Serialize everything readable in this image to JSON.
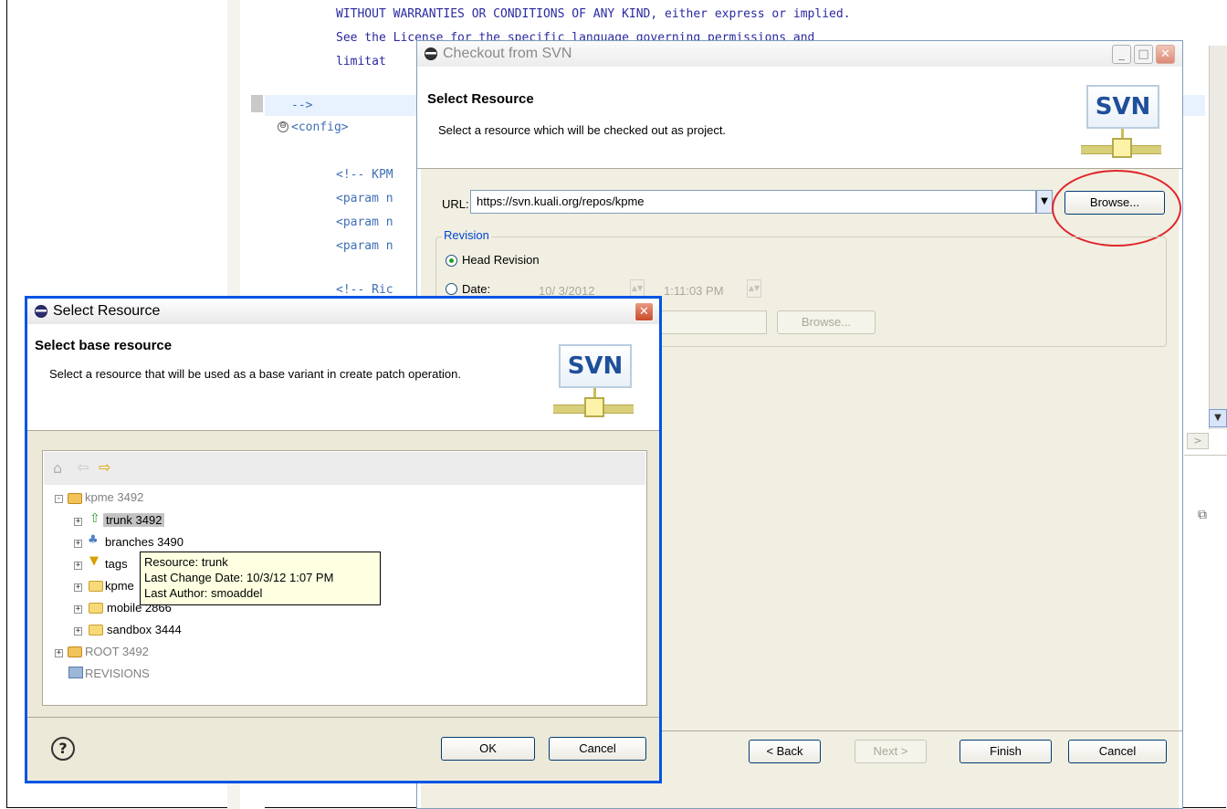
{
  "editor": {
    "lines": [
      "WITHOUT WARRANTIES OR CONDITIONS OF ANY KIND, either express or implied.",
      "See the License for the specific language governing permissions and",
      "limitat",
      "-->",
      "<config>",
      "<!-- KPM",
      "<param n",
      "<param n",
      "<param n",
      "<!-- Ric"
    ],
    "fold_symbol": "⊖"
  },
  "checkout": {
    "title": "Checkout from SVN",
    "header_title": "Select Resource",
    "header_desc": "Select a resource which will be checked out as project.",
    "logo_text": "SVN",
    "url_label": "URL:",
    "url_value": "https://svn.kuali.org/repos/kpme",
    "browse_label": "Browse...",
    "revision_legend": "Revision",
    "head_revision": "Head Revision",
    "date_label": "Date:",
    "date_value": "10/ 3/2012",
    "time_value": "1:11:03 PM",
    "browse2_label": "Browse...",
    "back_label": "< Back",
    "next_label": "Next >",
    "finish_label": "Finish",
    "cancel_label": "Cancel"
  },
  "select_dialog": {
    "title": "Select Resource",
    "header_title": "Select base resource",
    "header_desc": "Select a resource that will be used as a base variant in create patch operation.",
    "logo_text": "SVN",
    "tree": [
      {
        "label": "kpme 3492"
      },
      {
        "label": "trunk 3492"
      },
      {
        "label": "branches 3490"
      },
      {
        "label": "tags"
      },
      {
        "label": "kpme"
      },
      {
        "label": "mobile 2866"
      },
      {
        "label": "sandbox 3444"
      },
      {
        "label": "ROOT 3492"
      },
      {
        "label": "REVISIONS"
      }
    ],
    "tooltip": {
      "line1": "Resource: trunk",
      "line2": "Last Change Date: 10/3/12 1:07 PM",
      "line3": "Last Author: smoaddel"
    },
    "ok_label": "OK",
    "cancel_label": "Cancel",
    "help_symbol": "?"
  },
  "colors": {
    "accent": "#0054e3",
    "annotation_circle": "#e0262b"
  }
}
